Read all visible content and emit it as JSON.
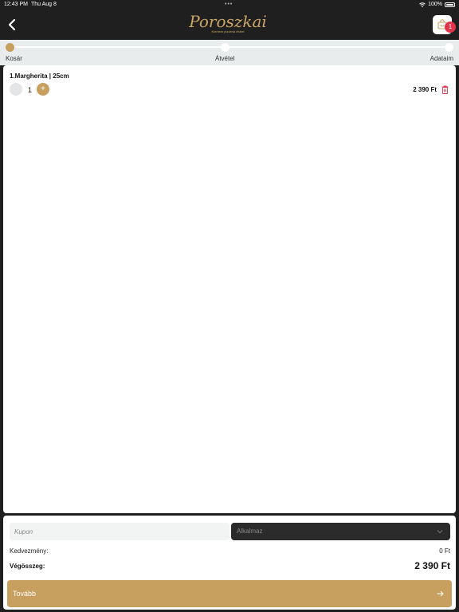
{
  "status_bar": {
    "time": "12:43 PM",
    "date": "Thu Aug 8",
    "battery": "100%"
  },
  "header": {
    "logo_title": "Poroszkai",
    "logo_subtitle": "Kiemem pizzéria elvitel",
    "cart_count": "1",
    "back_icon": "chevron-left-icon",
    "cart_icon": "shopping-bag-icon"
  },
  "steps": [
    {
      "label": "Kosár"
    },
    {
      "label": "Átvétel"
    },
    {
      "label": "Adataim"
    }
  ],
  "cart_items": [
    {
      "name": "1.Margherita | 25cm",
      "quantity": "1",
      "plus_label": "+",
      "price": "2 390 Ft"
    }
  ],
  "coupon": {
    "placeholder": "Kupon",
    "apply_label": "Alkalmaz"
  },
  "summary": {
    "discount_label": "Kedvezmény:",
    "discount_value": "0 Ft",
    "total_label": "Végösszeg:",
    "total_value": "2 390 Ft"
  },
  "next_button": {
    "label": "Tovább"
  },
  "colors": {
    "accent": "#c7a05f",
    "dark": "#1f1f1f",
    "badge": "#e0344a",
    "delete": "#e0344a"
  }
}
